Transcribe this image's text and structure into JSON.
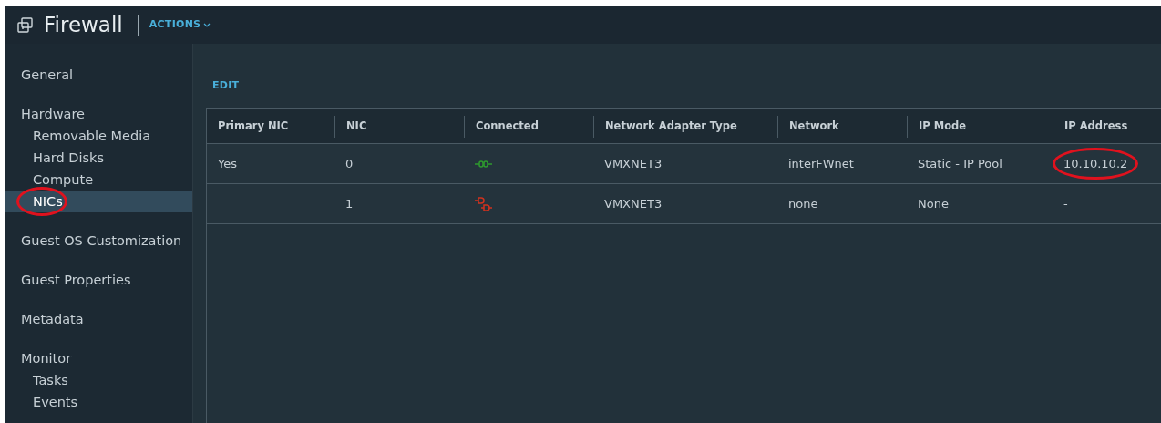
{
  "header": {
    "title": "Firewall",
    "actions": "ACTIONS"
  },
  "sidebar": [
    {
      "label": "General",
      "selected": false,
      "circled": false
    },
    {
      "label": "Hardware",
      "selected": false,
      "circled": false,
      "children": [
        {
          "label": "Removable Media",
          "selected": false,
          "circled": false
        },
        {
          "label": "Hard Disks",
          "selected": false,
          "circled": false
        },
        {
          "label": "Compute",
          "selected": false,
          "circled": false
        },
        {
          "label": "NICs",
          "selected": true,
          "circled": true
        }
      ]
    },
    {
      "label": "Guest OS Customization",
      "selected": false,
      "circled": false
    },
    {
      "label": "Guest Properties",
      "selected": false,
      "circled": false
    },
    {
      "label": "Metadata",
      "selected": false,
      "circled": false
    },
    {
      "label": "Monitor",
      "selected": false,
      "circled": false,
      "children": [
        {
          "label": "Tasks",
          "selected": false,
          "circled": false
        },
        {
          "label": "Events",
          "selected": false,
          "circled": false
        }
      ]
    }
  ],
  "edit_button": "EDIT",
  "table": {
    "columns": [
      "Primary NIC",
      "NIC",
      "Connected",
      "Network Adapter Type",
      "Network",
      "IP Mode",
      "IP Address"
    ],
    "rows": [
      {
        "primary_nic": "Yes",
        "nic": "0",
        "connected": true,
        "adapter_type": "VMXNET3",
        "network": "interFWnet",
        "ip_mode": "Static - IP Pool",
        "ip_address": "10.10.10.2",
        "ip_circled": true
      },
      {
        "primary_nic": "",
        "nic": "1",
        "connected": false,
        "adapter_type": "VMXNET3",
        "network": "none",
        "ip_mode": "None",
        "ip_address": "-",
        "ip_circled": false
      }
    ]
  }
}
